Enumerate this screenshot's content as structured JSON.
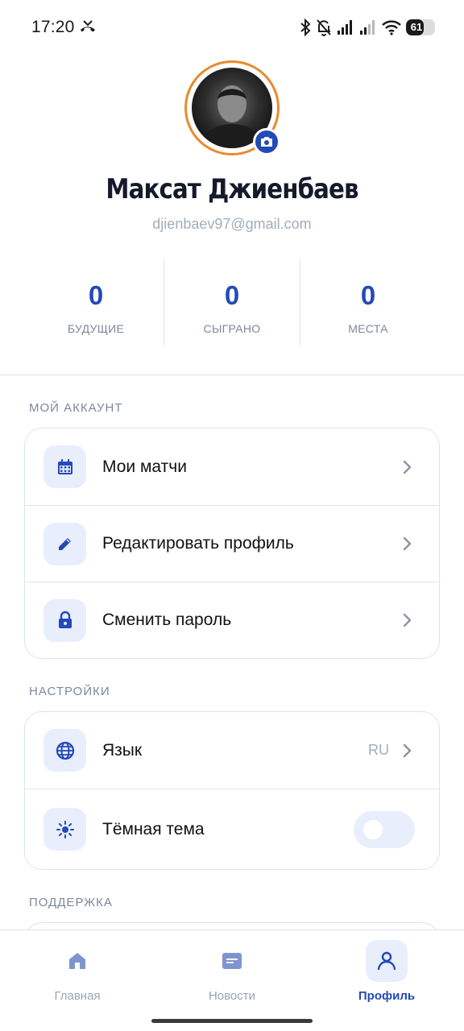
{
  "status_bar": {
    "time": "17:20",
    "battery_level": "61",
    "battery_fraction": 0.61,
    "icons": [
      "missed-call-icon",
      "bluetooth-icon",
      "bell-off-icon",
      "signal-icon",
      "signal-icon",
      "wifi-icon",
      "battery-icon"
    ]
  },
  "profile": {
    "name": "Максат Джиенбаев",
    "email": "djienbaev97@gmail.com",
    "avatar_icon": "avatar-photo",
    "camera_icon": "camera-icon"
  },
  "stats": [
    {
      "value": "0",
      "label": "БУДУЩИЕ"
    },
    {
      "value": "0",
      "label": "СЫГРАНО"
    },
    {
      "value": "0",
      "label": "МЕСТА"
    }
  ],
  "account_section": {
    "title": "МОЙ АККАУНТ",
    "items": [
      {
        "label": "Мои матчи",
        "icon": "calendar-icon"
      },
      {
        "label": "Редактировать профиль",
        "icon": "pencil-icon"
      },
      {
        "label": "Сменить пароль",
        "icon": "lock-icon"
      }
    ]
  },
  "settings_section": {
    "title": "НАСТРОЙКИ",
    "items": [
      {
        "label": "Язык",
        "value": "RU",
        "icon": "globe-icon"
      },
      {
        "label": "Тёмная тема",
        "icon": "sun-icon",
        "toggle_on": false
      }
    ]
  },
  "support_section": {
    "title": "ПОДДЕРЖКА"
  },
  "bottom_nav": {
    "items": [
      {
        "label": "Главная",
        "icon": "home-icon",
        "active": false
      },
      {
        "label": "Новости",
        "icon": "news-icon",
        "active": false
      },
      {
        "label": "Профиль",
        "icon": "profile-icon",
        "active": true
      }
    ]
  },
  "colors": {
    "accent": "#2449b8",
    "icon_bg": "#e8eefc",
    "avatar_ring": "#e98a2c",
    "border": "#dce4ef",
    "muted_text": "#7d8899"
  }
}
